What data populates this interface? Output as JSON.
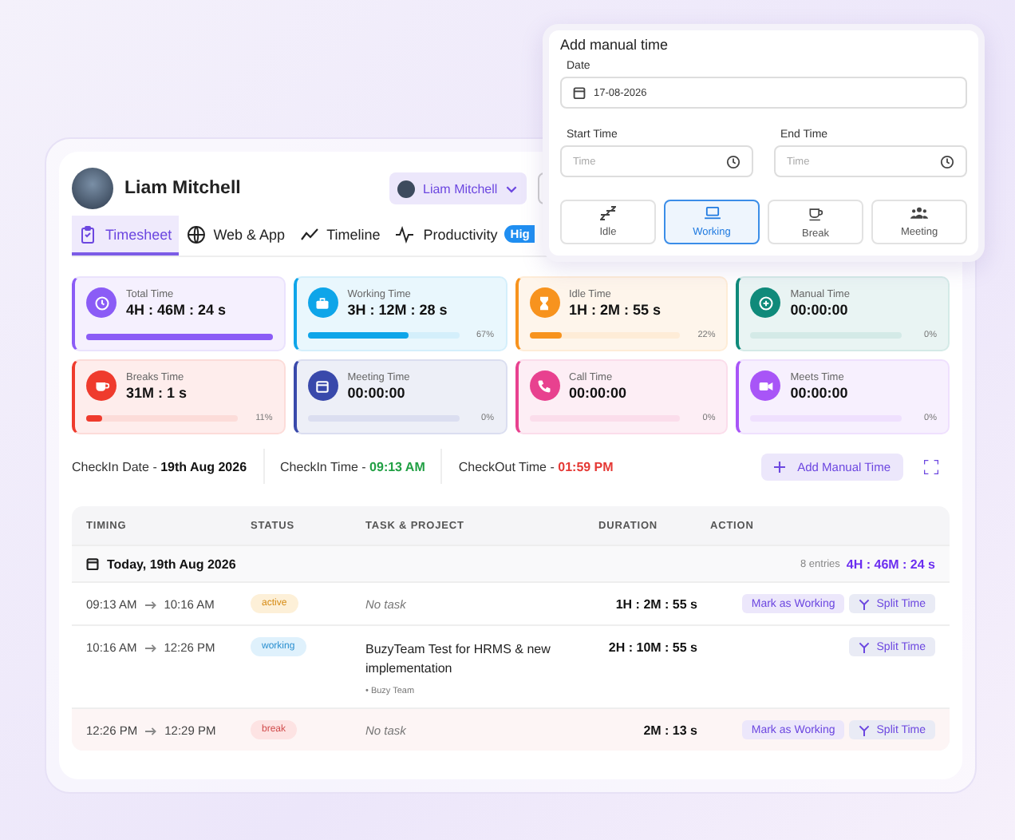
{
  "user": {
    "name": "Liam Mitchell"
  },
  "user_select": {
    "value": "Liam Mitchell"
  },
  "tabs": [
    {
      "label": "Timesheet",
      "kind": "clipboard",
      "selected": true
    },
    {
      "label": "Web & App",
      "kind": "globe",
      "selected": false
    },
    {
      "label": "Timeline",
      "kind": "trend",
      "selected": false
    },
    {
      "label": "Productivity",
      "kind": "pulse",
      "selected": false,
      "badge": "Hig"
    }
  ],
  "stats": [
    {
      "label": "Total Time",
      "value": "4H : 46M : 24 s",
      "kind": "clock",
      "color": "#8b5cf6",
      "level": 1
    },
    {
      "label": "Working Time",
      "value": "3H : 12M : 28 s",
      "kind": "briefcase",
      "color": "#0ea5e9",
      "level": 0.67,
      "percent": "67%"
    },
    {
      "label": "Idle Time",
      "value": "1H : 2M : 55 s",
      "kind": "hourglass",
      "color": "#f7931e",
      "level": 0.22,
      "percent": "22%"
    },
    {
      "label": "Manual Time",
      "value": "00:00:00",
      "kind": "plus",
      "color": "#0f8a7a",
      "level": 0,
      "percent": "0%"
    },
    {
      "label": "Breaks Time",
      "value": "31M : 1 s",
      "kind": "cup",
      "color": "#ef3b2d",
      "level": 0.11,
      "percent": "11%"
    },
    {
      "label": "Meeting Time",
      "value": "00:00:00",
      "kind": "calendar",
      "color": "#3949ab",
      "level": 0,
      "percent": "0%"
    },
    {
      "label": "Call Time",
      "value": "00:00:00",
      "kind": "phone",
      "color": "#e8418f",
      "level": 0,
      "percent": "0%"
    },
    {
      "label": "Meets Time",
      "value": "00:00:00",
      "kind": "video",
      "color": "#a855f7",
      "level": 0,
      "percent": "0%"
    }
  ],
  "checkin": [
    {
      "label": "CheckIn Date - ",
      "value": "19th Aug 2026",
      "kind": "date"
    },
    {
      "label": "CheckIn Time - ",
      "value": "09:13 AM",
      "kind": "in"
    },
    {
      "label": "CheckOut Time - ",
      "value": "01:59 PM",
      "kind": "out"
    }
  ],
  "add_button": {
    "label": "Add Manual Time"
  },
  "table": {
    "columns": [
      "TIMING",
      "STATUS",
      "TASK & PROJECT",
      "DURATION",
      "ACTION"
    ],
    "group": {
      "title": "Today, 19th Aug 2026",
      "entries": "8 entries",
      "total": "4H : 46M : 24 s"
    },
    "rows": [
      {
        "start": "09:13 AM",
        "end": "10:16 AM",
        "status": "active",
        "kind": "active",
        "task": "No task",
        "no_task": true,
        "duration": "1H : 2M : 55 s",
        "actions": [
          {
            "label": "Mark as Working",
            "kind": "mark"
          },
          {
            "label": "Split Time",
            "kind": "split"
          }
        ]
      },
      {
        "start": "10:16 AM",
        "end": "12:26 PM",
        "status": "working",
        "kind": "working",
        "task": "BuzyTeam Test for HRMS & new implementation",
        "no_task": false,
        "project": "• Buzy Team",
        "duration": "2H : 10M : 55 s",
        "actions": [
          {
            "label": "Split Time",
            "kind": "split"
          }
        ]
      },
      {
        "start": "12:26 PM",
        "end": "12:29 PM",
        "status": "break",
        "kind": "break",
        "task": "No task",
        "no_task": true,
        "duration": "2M : 13 s",
        "actions": [
          {
            "label": "Mark as Working",
            "kind": "mark"
          },
          {
            "label": "Split Time",
            "kind": "split"
          }
        ]
      }
    ]
  },
  "manual_time": {
    "title": "Add manual time",
    "date_label": "Date",
    "date_value": "17-08-2026",
    "start_label": "Start Time",
    "start_placeholder": "Time",
    "end_label": "End Time",
    "end_placeholder": "Time",
    "types": [
      {
        "label": "Idle",
        "kind": "sleep",
        "selected": false
      },
      {
        "label": "Working",
        "kind": "laptop",
        "selected": true
      },
      {
        "label": "Break",
        "kind": "cup",
        "selected": false
      },
      {
        "label": "Meeting",
        "kind": "people",
        "selected": false
      }
    ]
  }
}
